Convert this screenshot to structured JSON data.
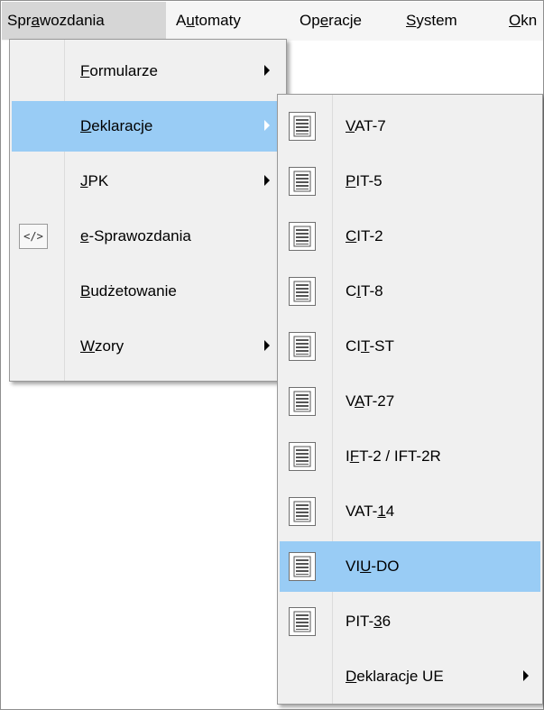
{
  "menubar": [
    {
      "pre": "Spr",
      "mn": "a",
      "post": "wozdania",
      "active": true
    },
    {
      "pre": "A",
      "mn": "u",
      "post": "tomaty"
    },
    {
      "pre": "Op",
      "mn": "e",
      "post": "racje"
    },
    {
      "pre": "",
      "mn": "S",
      "post": "ystem"
    },
    {
      "pre": "",
      "mn": "O",
      "post": "kn"
    }
  ],
  "menu1": [
    {
      "pre": "",
      "mn": "F",
      "post": "ormularze",
      "submenu": true
    },
    {
      "pre": "",
      "mn": "D",
      "post": "eklaracje",
      "submenu": true,
      "highlighted": true
    },
    {
      "pre": "",
      "mn": "J",
      "post": "PK",
      "submenu": true
    },
    {
      "pre": "",
      "mn": "e",
      "post": "-Sprawozdania",
      "icon": "code-icon",
      "icon_text": "</>"
    },
    {
      "pre": "",
      "mn": "B",
      "post": "udżetowanie"
    },
    {
      "pre": "",
      "mn": "W",
      "post": "zory",
      "submenu": true
    }
  ],
  "menu2": [
    {
      "pre": "",
      "mn": "V",
      "post": "AT-7",
      "icon": "document-icon"
    },
    {
      "pre": "",
      "mn": "P",
      "post": "IT-5",
      "icon": "document-icon"
    },
    {
      "pre": "",
      "mn": "C",
      "post": "IT-2",
      "icon": "document-icon"
    },
    {
      "pre": "C",
      "mn": "I",
      "post": "T-8",
      "icon": "document-icon"
    },
    {
      "pre": "CI",
      "mn": "T",
      "post": "-ST",
      "icon": "document-icon"
    },
    {
      "pre": "V",
      "mn": "A",
      "post": "T-27",
      "icon": "document-icon"
    },
    {
      "pre": "I",
      "mn": "F",
      "post": "T-2 / IFT-2R",
      "icon": "document-icon"
    },
    {
      "pre": "VAT-",
      "mn": "1",
      "post": "4",
      "icon": "document-icon"
    },
    {
      "pre": "VI",
      "mn": "U",
      "post": "-DO",
      "icon": "document-icon",
      "highlighted": true
    },
    {
      "pre": "PIT-",
      "mn": "3",
      "post": "6",
      "icon": "document-icon"
    },
    {
      "pre": "",
      "mn": "D",
      "post": "eklaracje UE",
      "submenu": true
    }
  ],
  "colors": {
    "highlight": "#99ccf5",
    "menubar_active": "#d6d6d6",
    "menu_bg": "#f0f0f0"
  }
}
